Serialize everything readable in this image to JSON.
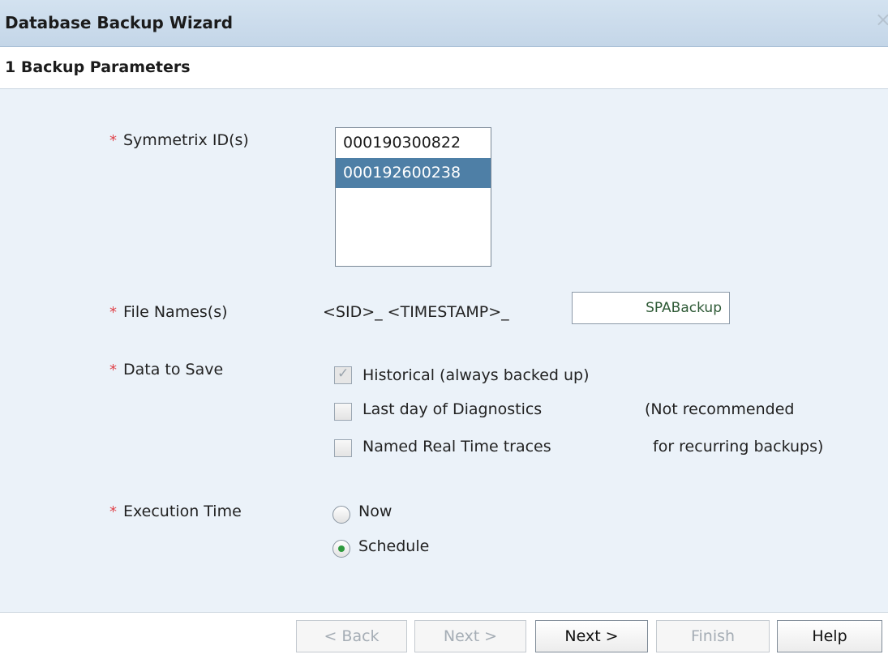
{
  "window": {
    "title": "Database Backup Wizard",
    "close_glyph": "×"
  },
  "step": {
    "title": "1 Backup Parameters"
  },
  "form": {
    "required_marker": "*",
    "symmetrix": {
      "label": "Symmetrix ID(s)",
      "items": [
        "000190300822",
        "000192600238"
      ],
      "selected_index": 1
    },
    "file_names": {
      "label": "File Names(s)",
      "prefix": "<SID>_ <TIMESTAMP>_",
      "value": "SPABackup"
    },
    "data_to_save": {
      "label": "Data to Save",
      "options": [
        {
          "label": "Historical (always backed up)",
          "checked": true,
          "disabled": true
        },
        {
          "label": "Last day of Diagnostics",
          "checked": false
        },
        {
          "label": "Named Real Time traces",
          "checked": false
        }
      ],
      "note_line1": "(Not recommended",
      "note_line2": "for recurring backups)"
    },
    "execution_time": {
      "label": "Execution Time",
      "options": [
        {
          "label": "Now",
          "selected": false
        },
        {
          "label": "Schedule",
          "selected": true
        }
      ]
    }
  },
  "footer": {
    "buttons": [
      {
        "label": "< Back",
        "state": "disabled"
      },
      {
        "label": "Next >",
        "state": "disabled"
      },
      {
        "label": "Next >",
        "state": "enabled"
      },
      {
        "label": "Finish",
        "state": "disabled"
      },
      {
        "label": "Help",
        "state": "enabled"
      }
    ]
  },
  "colors": {
    "title_bar": "#c9daea",
    "content_bg": "#ebf2f9",
    "selection": "#4e7fa6",
    "required": "#e0434a",
    "radio_selected": "#2f9a3d"
  }
}
